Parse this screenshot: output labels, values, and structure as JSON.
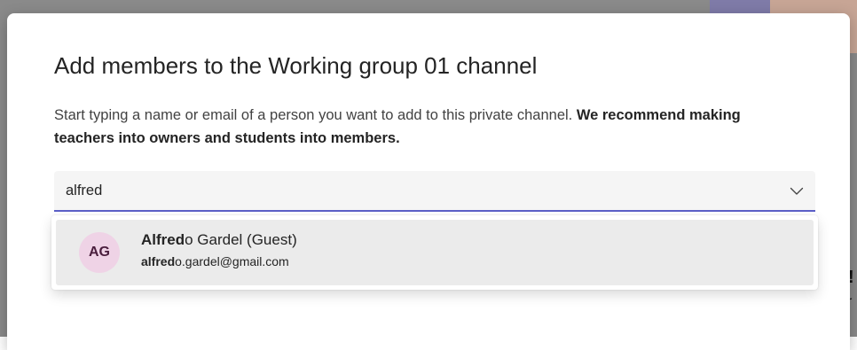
{
  "dialog": {
    "title": "Add members to the Working group 01 channel",
    "description_plain": "Start typing a name or email of a person you want to add to this private channel. ",
    "description_bold": "We recommend making teachers into owners and students into members."
  },
  "search": {
    "value": "alfred",
    "chevron_icon": "chevron-down-icon",
    "focus_color": "#5b5fc7"
  },
  "results": [
    {
      "avatar_initials": "AG",
      "avatar_color": "#efd3e6",
      "name_match": "Alfred",
      "name_rest": "o Gardel (Guest)",
      "email_match": "alfred",
      "email_rest": "o.gardel@gmail.com"
    }
  ],
  "background": {
    "glyph_1": "!",
    "glyph_2": "r"
  }
}
